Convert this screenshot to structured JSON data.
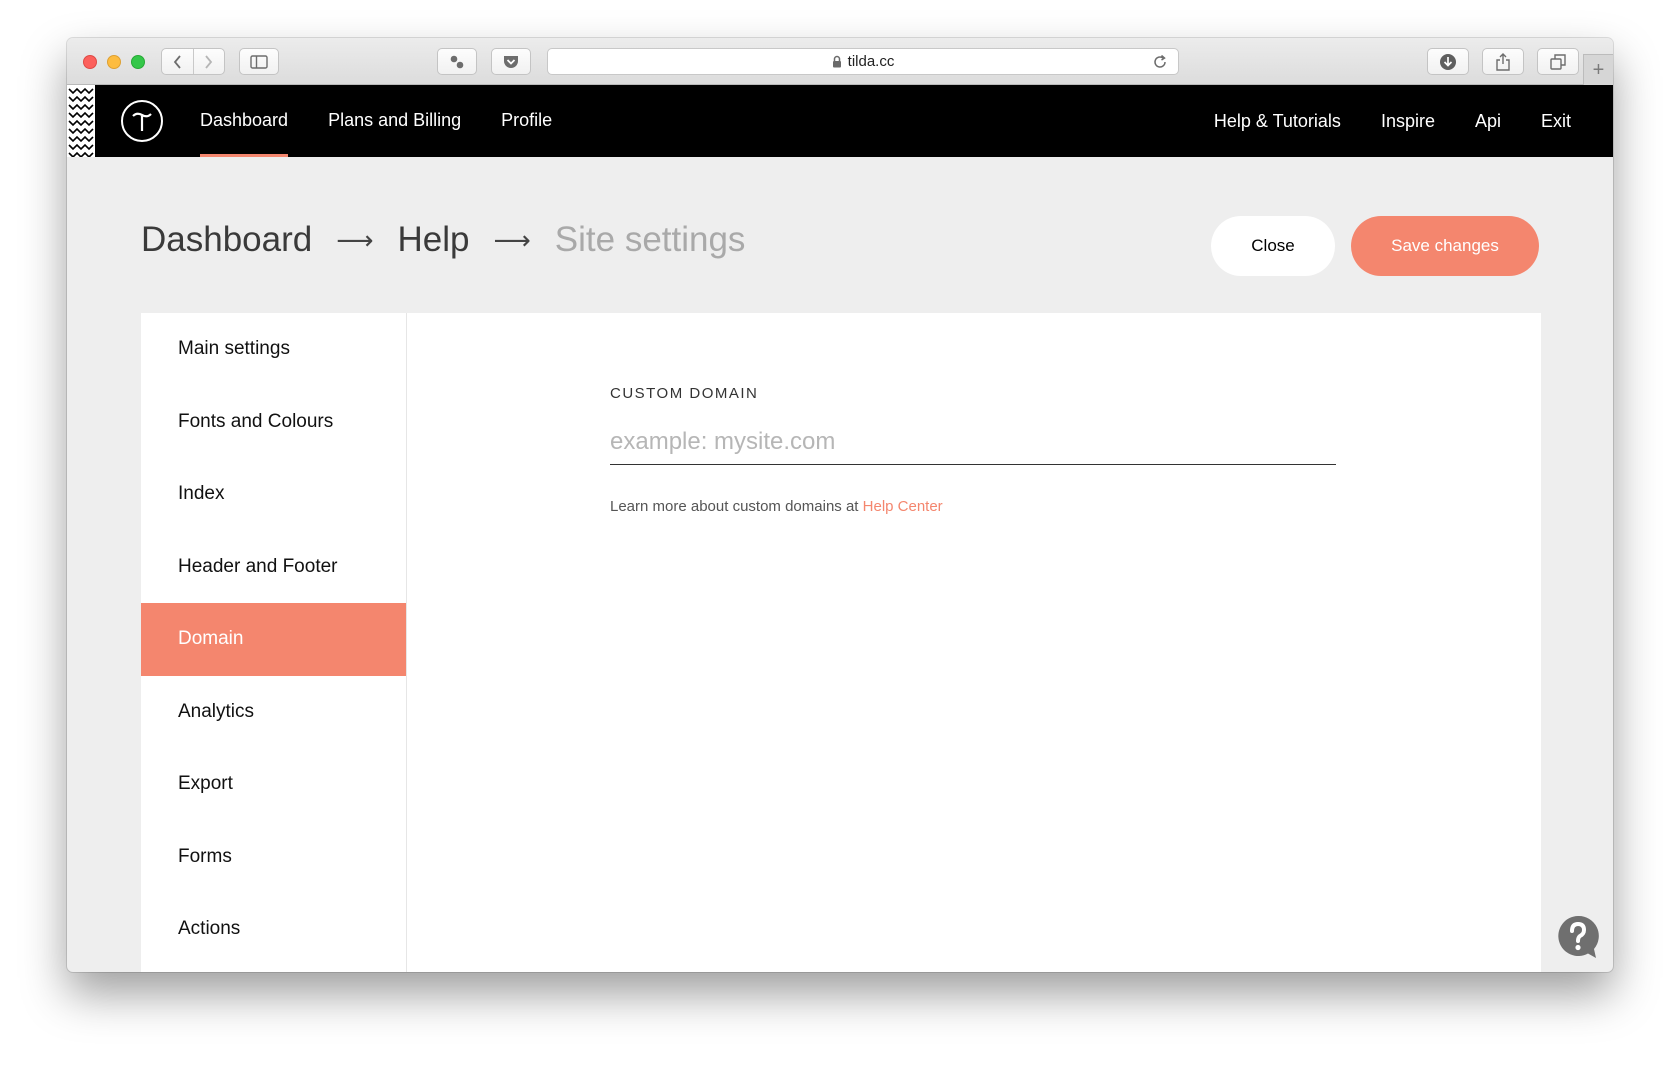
{
  "browser": {
    "url": "tilda.cc",
    "icons": [
      "back-icon",
      "forward-icon",
      "sidebar-icon",
      "extension-icon",
      "pocket-icon",
      "lock-icon",
      "reload-icon",
      "download-icon",
      "share-icon",
      "tabs-icon",
      "new-tab-icon"
    ]
  },
  "header": {
    "logo_icon": "tilda-logo-icon",
    "nav": [
      {
        "label": "Dashboard",
        "active": true
      },
      {
        "label": "Plans and Billing"
      },
      {
        "label": "Profile"
      }
    ],
    "right_nav": [
      {
        "label": "Help & Tutorials"
      },
      {
        "label": "Inspire"
      },
      {
        "label": "Api"
      },
      {
        "label": "Exit"
      }
    ]
  },
  "breadcrumb": {
    "items": [
      "Dashboard",
      "Help",
      "Site settings"
    ],
    "separator": "⟶"
  },
  "actions": {
    "close_label": "Close",
    "save_label": "Save changes"
  },
  "sidebar": {
    "items": [
      {
        "label": "Main settings"
      },
      {
        "label": "Fonts and Colours"
      },
      {
        "label": "Index"
      },
      {
        "label": "Header and Footer"
      },
      {
        "label": "Domain",
        "active": true
      },
      {
        "label": "Analytics"
      },
      {
        "label": "Export"
      },
      {
        "label": "Forms"
      },
      {
        "label": "Actions"
      }
    ]
  },
  "domain": {
    "label": "CUSTOM DOMAIN",
    "value": "",
    "placeholder": "example: mysite.com",
    "hint_text": "Learn more about custom domains at ",
    "hint_link": "Help Center"
  },
  "colors": {
    "accent": "#f4866e",
    "header_bg": "#000000",
    "page_bg": "#eeeeee"
  }
}
